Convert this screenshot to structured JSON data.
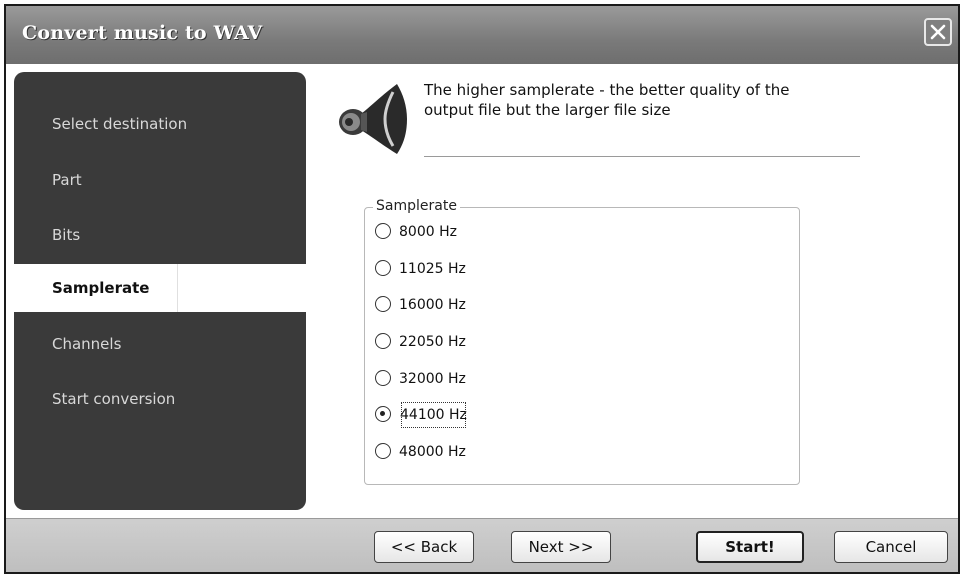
{
  "window": {
    "title": "Convert music to WAV"
  },
  "sidebar": {
    "items": [
      {
        "label": "Select destination",
        "active": false
      },
      {
        "label": "Part",
        "active": false
      },
      {
        "label": "Bits",
        "active": false
      },
      {
        "label": "Samplerate",
        "active": true
      },
      {
        "label": "Channels",
        "active": false
      },
      {
        "label": "Start conversion",
        "active": false
      }
    ]
  },
  "description": {
    "line1": "The higher samplerate  - the better quality of the",
    "line2": "output file but the larger file size"
  },
  "samplerate": {
    "legend": "Samplerate",
    "options": [
      "8000 Hz",
      "11025 Hz",
      "16000 Hz",
      "22050 Hz",
      "32000 Hz",
      "44100 Hz",
      "48000 Hz"
    ],
    "selected": "44100 Hz"
  },
  "buttons": {
    "back": "<< Back",
    "next": "Next >>",
    "start": "Start!",
    "cancel": "Cancel"
  },
  "icons": {
    "close": "close-icon",
    "speaker": "speaker-icon"
  }
}
